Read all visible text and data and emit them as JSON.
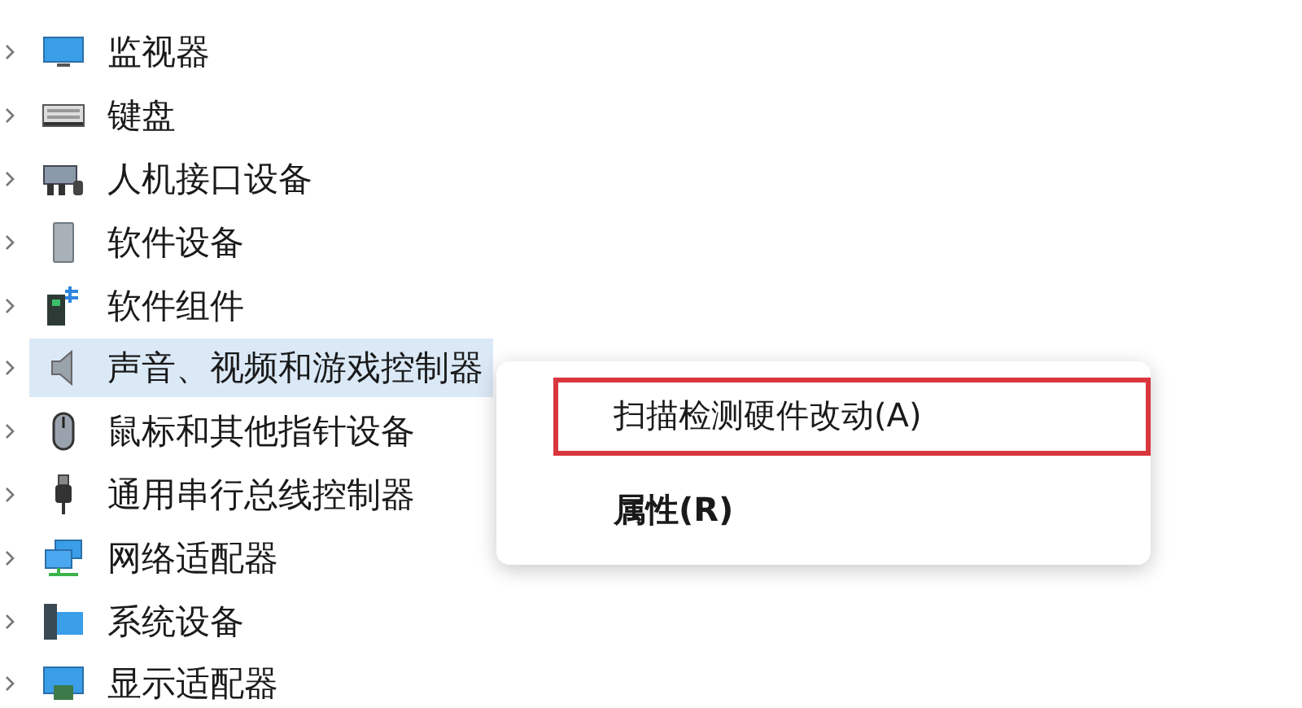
{
  "tree": {
    "items": [
      {
        "label": "监视器",
        "kind": "monitor",
        "selected": false,
        "expanded": false
      },
      {
        "label": "键盘",
        "kind": "keyboard",
        "selected": false,
        "expanded": false
      },
      {
        "label": "人机接口设备",
        "kind": "hid",
        "selected": false,
        "expanded": false
      },
      {
        "label": "软件设备",
        "kind": "software-device",
        "selected": false,
        "expanded": false
      },
      {
        "label": "软件组件",
        "kind": "software-component",
        "selected": false,
        "expanded": false
      },
      {
        "label": "声音、视频和游戏控制器",
        "kind": "speaker",
        "selected": true,
        "expanded": false
      },
      {
        "label": "鼠标和其他指针设备",
        "kind": "mouse",
        "selected": false,
        "expanded": false
      },
      {
        "label": "通用串行总线控制器",
        "kind": "usb",
        "selected": false,
        "expanded": false
      },
      {
        "label": "网络适配器",
        "kind": "network",
        "selected": false,
        "expanded": false
      },
      {
        "label": "系统设备",
        "kind": "system",
        "selected": false,
        "expanded": false
      },
      {
        "label": "显示适配器",
        "kind": "display",
        "selected": false,
        "expanded": false
      }
    ]
  },
  "context_menu": {
    "items": [
      {
        "label": "扫描检测硬件改动(A)",
        "highlighted": true,
        "default": false
      },
      {
        "label": "属性(R)",
        "highlighted": false,
        "default": true
      }
    ]
  }
}
